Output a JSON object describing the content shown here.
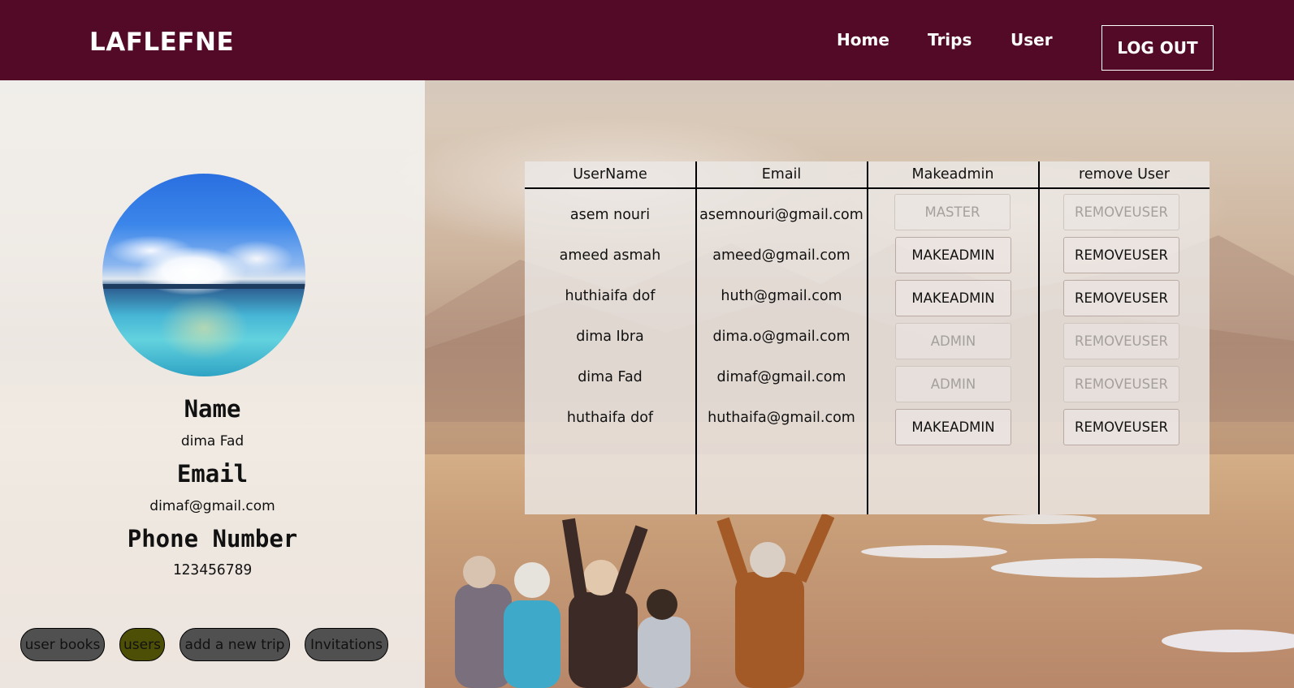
{
  "navbar": {
    "brand": "LAFLEFNE",
    "links": [
      "Home",
      "Trips",
      "User"
    ],
    "logout_label": "LOG OUT"
  },
  "profile": {
    "name_label": "Name",
    "name_value": "dima Fad",
    "email_label": "Email",
    "email_value": "dimaf@gmail.com",
    "phone_label": "Phone Number",
    "phone_value": "123456789"
  },
  "sidebar_tabs": [
    {
      "label": "user books",
      "active": false
    },
    {
      "label": "users",
      "active": true
    },
    {
      "label": "add a new trip",
      "active": false
    },
    {
      "label": "Invitations",
      "active": false
    }
  ],
  "users_table": {
    "headers": [
      "UserName",
      "Email",
      "Makeadmin",
      "remove User"
    ],
    "rows": [
      {
        "username": "asem nouri",
        "email": "asemnouri@gmail.com",
        "admin_action": "MASTER",
        "admin_enabled": false,
        "remove_label": "REMOVEUSER",
        "remove_enabled": false
      },
      {
        "username": "ameed asmah",
        "email": "ameed@gmail.com",
        "admin_action": "MAKEADMIN",
        "admin_enabled": true,
        "remove_label": "REMOVEUSER",
        "remove_enabled": true
      },
      {
        "username": "huthiaifa dof",
        "email": "huth@gmail.com",
        "admin_action": "MAKEADMIN",
        "admin_enabled": true,
        "remove_label": "REMOVEUSER",
        "remove_enabled": true
      },
      {
        "username": "dima Ibra",
        "email": "dima.o@gmail.com",
        "admin_action": "ADMIN",
        "admin_enabled": false,
        "remove_label": "REMOVEUSER",
        "remove_enabled": false
      },
      {
        "username": "dima Fad",
        "email": "dimaf@gmail.com",
        "admin_action": "ADMIN",
        "admin_enabled": false,
        "remove_label": "REMOVEUSER",
        "remove_enabled": false
      },
      {
        "username": "huthaifa dof",
        "email": "huthaifa@gmail.com",
        "admin_action": "MAKEADMIN",
        "admin_enabled": true,
        "remove_label": "REMOVEUSER",
        "remove_enabled": true
      }
    ]
  },
  "colors": {
    "navbar": "#520a26",
    "active_tab": "#4d4f06",
    "tab": "#505050"
  }
}
